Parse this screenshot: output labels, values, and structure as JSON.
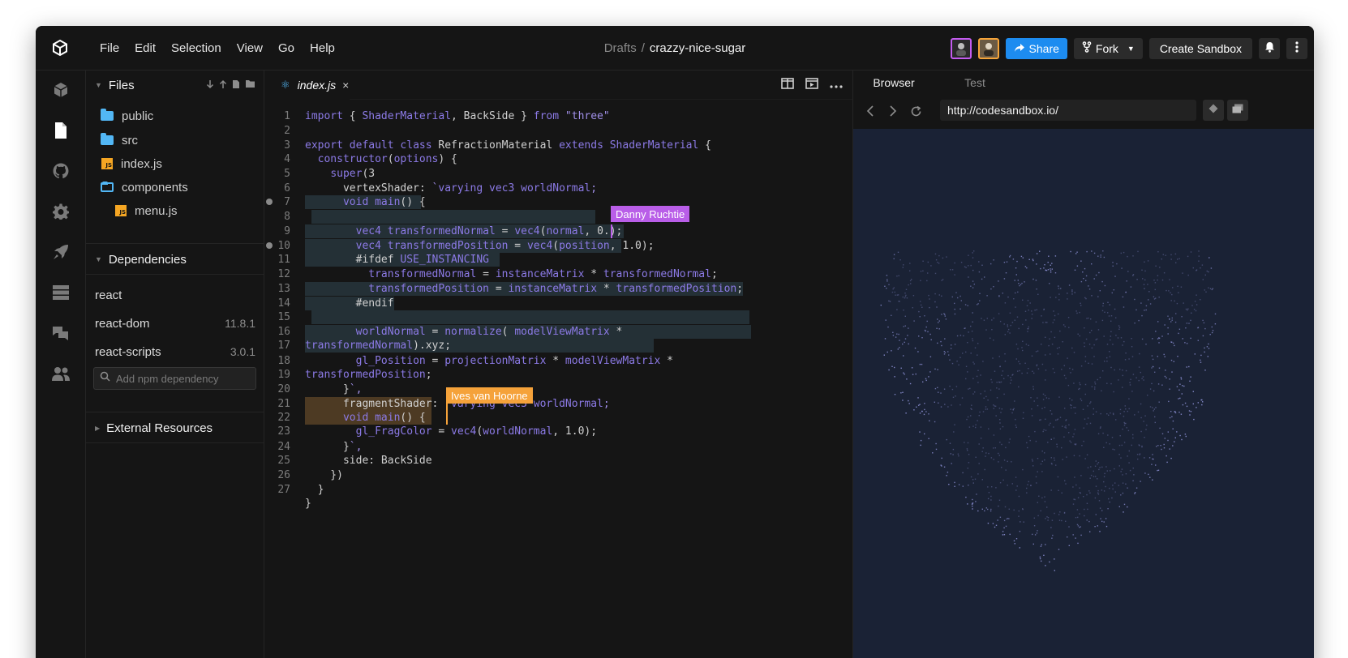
{
  "app": {
    "menu": [
      "File",
      "Edit",
      "Selection",
      "View",
      "Go",
      "Help"
    ],
    "breadcrumb": {
      "folder": "Drafts",
      "separator": "/",
      "sandbox": "crazzy-nice-sugar"
    },
    "share_label": "Share",
    "fork_label": "Fork",
    "create_label": "Create Sandbox"
  },
  "activity_icons": [
    "cube-icon",
    "file-icon",
    "github-icon",
    "gear-icon",
    "rocket-icon",
    "server-icon",
    "chat-icon",
    "users-icon"
  ],
  "sidebar": {
    "files_title": "Files",
    "files": [
      {
        "name": "public",
        "type": "folder"
      },
      {
        "name": "src",
        "type": "folder"
      },
      {
        "name": "index.js",
        "type": "js"
      },
      {
        "name": "components",
        "type": "folder-open"
      },
      {
        "name": "menu.js",
        "type": "js"
      }
    ],
    "dependencies_title": "Dependencies",
    "dependencies": [
      {
        "name": "react",
        "version": ""
      },
      {
        "name": "react-dom",
        "version": "11.8.1"
      },
      {
        "name": "react-scripts",
        "version": "3.0.1"
      }
    ],
    "npm_placeholder": "Add npm dependency",
    "external_title": "External Resources"
  },
  "editor": {
    "tab_label": "index.js",
    "tab_close": "×",
    "lines": [
      "import { ShaderMaterial, BackSide } from \"three\"",
      "",
      "export default class RefractionMaterial extends ShaderMaterial {",
      "  constructor(options) {",
      "    super(3",
      "      vertexShader: `varying vec3 worldNormal;",
      "      void main() {",
      "",
      "        vec4 transformedNormal = vec4(normal, 0.);",
      "        vec4 transformedPosition = vec4(position, 1.0);",
      "        #ifdef USE_INSTANCING",
      "          transformedNormal = instanceMatrix * transformedNormal;",
      "          transformedPosition = instanceMatrix * transformedPosition;",
      "        #endif",
      "",
      "        worldNormal = normalize( modelViewMatrix *",
      "transformedNormal).xyz;",
      "        gl_Position = projectionMatrix * modelViewMatrix *",
      "transformedPosition;",
      "      }`,",
      "      fragmentShader: `varying vec3 worldNormal;",
      "      void main() {",
      "        gl_FragColor = vec4(worldNormal, 1.0);",
      "      }`,",
      "      side: BackSide",
      "    })",
      "  }",
      "}"
    ],
    "line_numbers": [
      "1",
      "2",
      "3",
      "4",
      "5",
      "6",
      "7",
      "8",
      "9",
      "10",
      "11",
      "12",
      "13",
      "14",
      "15",
      "16",
      "17",
      "18",
      "19",
      "20",
      "21",
      "22",
      "23",
      "24",
      "25",
      "26",
      "27",
      ""
    ],
    "collaborators": [
      {
        "name": "Danny Ruchtie",
        "color": "#b95ee8"
      },
      {
        "name": "Ives van Hoorne",
        "color": "#f5a23a"
      }
    ]
  },
  "preview": {
    "tabs": [
      "Browser",
      "Test"
    ],
    "url": "http://codesandbox.io/",
    "background": "#1a2235",
    "particle_color": "#8f93d8"
  }
}
